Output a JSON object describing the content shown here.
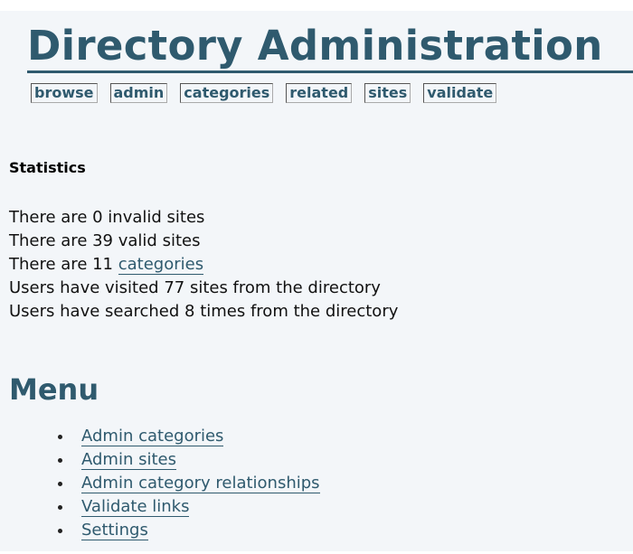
{
  "header": {
    "title": "Directory Administration"
  },
  "tabs": [
    {
      "label": "browse"
    },
    {
      "label": "admin"
    },
    {
      "label": "categories"
    },
    {
      "label": "related"
    },
    {
      "label": "sites"
    },
    {
      "label": "validate"
    }
  ],
  "statistics": {
    "heading": "Statistics",
    "invalid_sites": "There are 0 invalid sites",
    "valid_sites": "There are 39 valid sites",
    "categories_prefix": "There are 11 ",
    "categories_link": "categories",
    "visits": "Users have visited 77 sites from the directory",
    "searches": "Users have searched 8 times from the directory"
  },
  "menu": {
    "heading": "Menu",
    "items": [
      {
        "label": "Admin categories"
      },
      {
        "label": "Admin sites"
      },
      {
        "label": "Admin category relationships"
      },
      {
        "label": "Validate links"
      },
      {
        "label": "Settings"
      }
    ]
  },
  "colors": {
    "accent": "#2f5a6e",
    "panel_background": "#f3f6f9"
  }
}
